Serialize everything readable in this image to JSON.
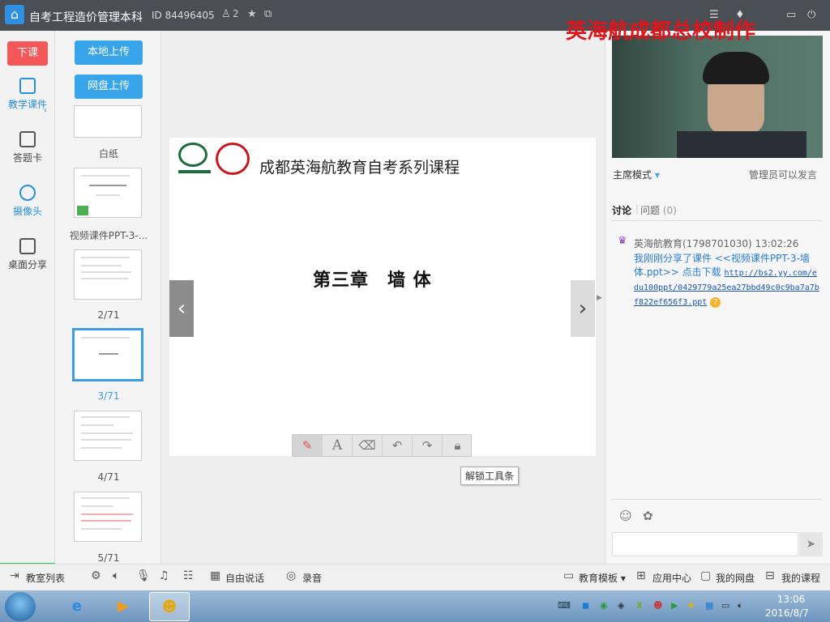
{
  "titlebar": {
    "app_title": "自考工程造价管理本科",
    "room_id": "ID 84496405",
    "user_count": "2"
  },
  "watermark": "英海航成都总校制作",
  "leftnav": {
    "end_class": "下课",
    "items": [
      {
        "label": "教学课件"
      },
      {
        "label": "答题卡"
      },
      {
        "label": "摄像头"
      },
      {
        "label": "桌面分享"
      }
    ]
  },
  "thumbs": {
    "upload_local": "本地上传",
    "upload_cloud": "网盘上传",
    "items": [
      {
        "label": "白纸"
      },
      {
        "label": "视频课件PPT-3-..."
      },
      {
        "label": "2/71"
      },
      {
        "label": "3/71"
      },
      {
        "label": "4/71"
      },
      {
        "label": "5/71"
      }
    ]
  },
  "slide": {
    "course_title": "成都英海航教育自考系列课程",
    "chapter": "第三章　墙 体",
    "tooltip": "解锁工具条"
  },
  "rightpanel": {
    "mode": "主席模式",
    "admin_speak": "管理员可以发言",
    "tab_discuss": "讨论",
    "tab_question": "问题",
    "question_count": "(0)",
    "message": {
      "author": "英海航教育(1798701030) 13:02:26",
      "text": "我刚刚分享了课件 <<视频课件PPT-3-墙体.ppt>> 点击下载",
      "link": "http://bs2.yy.com/edu100ppt/0429779a25ea27bbd49c0c9ba7a7bf822ef656f3.ppt"
    }
  },
  "bottombar": {
    "room_list": "教室列表",
    "free_speak": "自由说话",
    "record": "录音",
    "edu_template": "教育模板",
    "app_center": "应用中心",
    "my_disk": "我的网盘",
    "my_course": "我的课程"
  },
  "taskbar": {
    "time": "13:06",
    "date": "2016/8/7"
  }
}
